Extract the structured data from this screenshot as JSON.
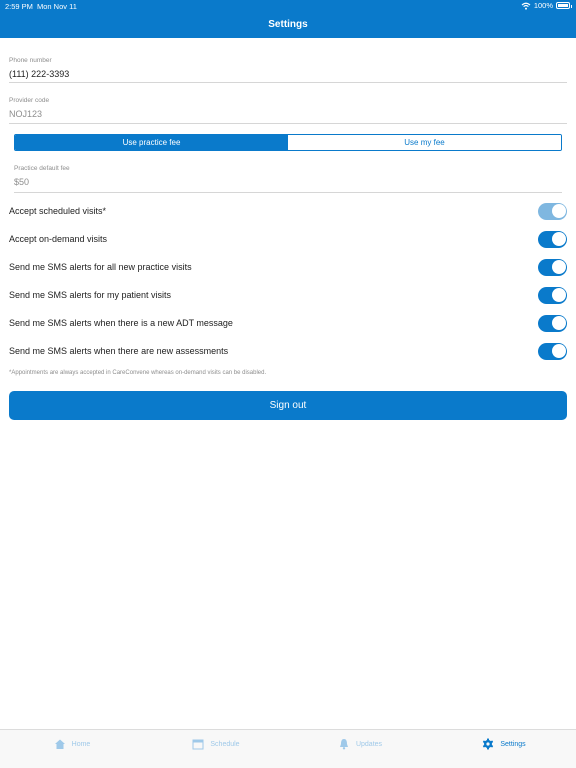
{
  "status": {
    "time": "2:59 PM",
    "date": "Mon Nov 11",
    "battery": "100%"
  },
  "header": {
    "title": "Settings"
  },
  "phone": {
    "label": "Phone number",
    "value": "(111) 222-3393"
  },
  "provider": {
    "label": "Provider code",
    "value": "NOJ123"
  },
  "fee_segment": {
    "options": [
      "Use practice fee",
      "Use my fee"
    ],
    "selected": "Use practice fee"
  },
  "fee": {
    "label": "Practice default fee",
    "value": "$50"
  },
  "toggles": [
    {
      "label": "Accept scheduled visits*",
      "on": true,
      "disabled": true
    },
    {
      "label": "Accept on-demand visits",
      "on": true,
      "disabled": false
    },
    {
      "label": "Send me SMS alerts for all new practice visits",
      "on": true,
      "disabled": false
    },
    {
      "label": "Send me SMS alerts for my patient visits",
      "on": true,
      "disabled": false
    },
    {
      "label": "Send me SMS alerts when there is a new ADT message",
      "on": true,
      "disabled": false
    },
    {
      "label": "Send me SMS alerts when there are new assessments",
      "on": true,
      "disabled": false
    }
  ],
  "footnote": "*Appointments are always accepted in CareConvene whereas on-demand visits can be disabled.",
  "signout_label": "Sign out",
  "tabs": [
    {
      "label": "Home",
      "icon": "home-icon",
      "active": false
    },
    {
      "label": "Schedule",
      "icon": "calendar-icon",
      "active": false
    },
    {
      "label": "Updates",
      "icon": "bell-icon",
      "active": false
    },
    {
      "label": "Settings",
      "icon": "gear-icon",
      "active": true
    }
  ],
  "colors": {
    "primary": "#0a7acb",
    "toggle_disabled": "#7fb7e0",
    "tab_inactive": "#9fc9e9"
  }
}
